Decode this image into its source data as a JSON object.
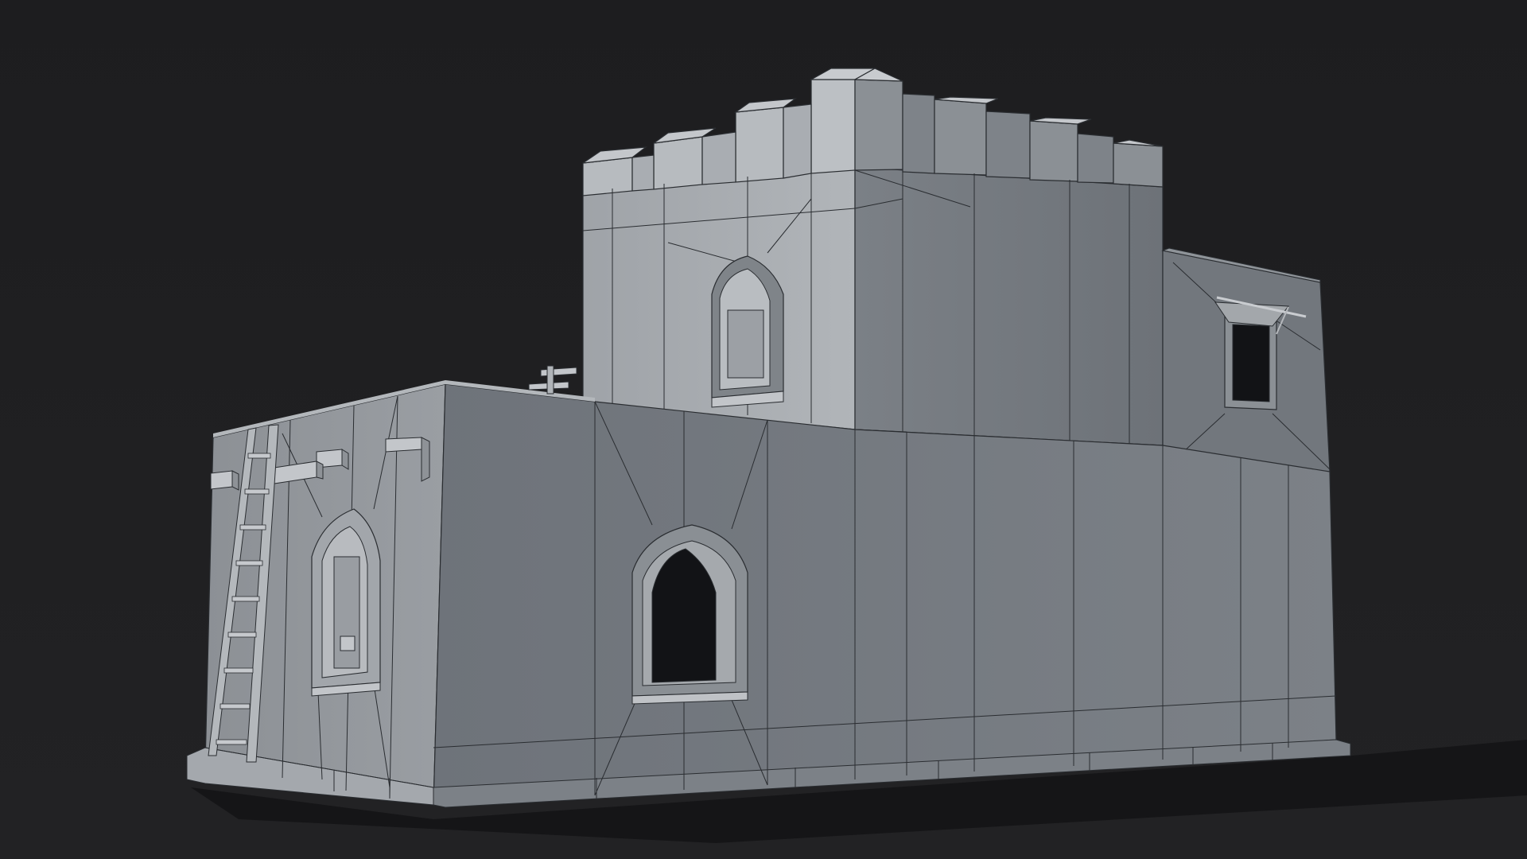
{
  "scene": {
    "subject": "castle-keep-wireframe-render",
    "colors": {
      "background": "#1f1f21",
      "wall_lit": "#a6aaaf",
      "wall_mid": "#8d9196",
      "wall_front": "#767b81",
      "wall_shade": "#5b6067",
      "wireframe": "#2a2d31",
      "window_void": "#121316",
      "shadow": "#121214"
    },
    "icons": [
      "ladder-icon",
      "window-icon",
      "battlement-icon"
    ]
  }
}
